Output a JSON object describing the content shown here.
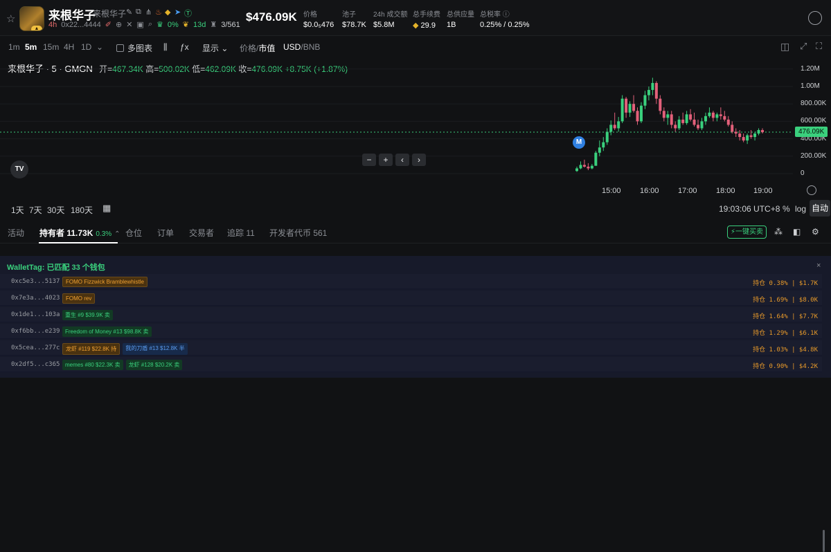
{
  "token": {
    "name": "来根华子",
    "subname": "来根华子",
    "timeframe": "4h",
    "address": "0x22...4444",
    "pct": "0%",
    "age": "13d",
    "holders_ratio": "3/561"
  },
  "header": {
    "price": "$476.09K",
    "stats": [
      {
        "label": "价格",
        "value": "$0.0₅476"
      },
      {
        "label": "池子",
        "value": "$78.7K"
      },
      {
        "label": "24h 成交额",
        "value": "$5.8M"
      },
      {
        "label": "总手续费",
        "value": "29.9"
      },
      {
        "label": "总供应量",
        "value": "1B"
      },
      {
        "label": "总税率",
        "value": "0.25% / 0.25%"
      }
    ]
  },
  "toolbar": {
    "intervals": [
      "1m",
      "5m",
      "15m",
      "4H",
      "1D"
    ],
    "active_interval": "5m",
    "multi_chart": "多图表",
    "display": "显示",
    "price_label": "价格",
    "mcap_label": "市值",
    "sep": "/",
    "usd": "USD",
    "bnb": "BNB"
  },
  "legend": {
    "title": "来根华子 · 5 · GMGN",
    "open_label": "开=",
    "open": "467.34K",
    "high_label": "高=",
    "high": "500.02K",
    "low_label": "低=",
    "low": "462.09K",
    "close_label": "收=",
    "close": "476.09K",
    "change": "+8.75K (+1.87%)"
  },
  "chart_data": {
    "type": "candlestick",
    "y_unit": "market cap (USD)",
    "ylim": [
      -50000,
      1250000
    ],
    "y_ticks": [
      "1.20M",
      "1.00M",
      "800.00K",
      "600.00K",
      "400.00K",
      "200.00K",
      "0"
    ],
    "x_ticks": [
      "15:00",
      "16:00",
      "17:00",
      "18:00",
      "19:00"
    ],
    "current": "476.09K",
    "current_value": 476090,
    "candles": [
      [
        30,
        80,
        20,
        60
      ],
      [
        60,
        140,
        50,
        100
      ],
      [
        100,
        160,
        70,
        80
      ],
      [
        80,
        120,
        40,
        60
      ],
      [
        60,
        110,
        50,
        90
      ],
      [
        90,
        260,
        90,
        240
      ],
      [
        240,
        380,
        200,
        300
      ],
      [
        300,
        420,
        260,
        360
      ],
      [
        360,
        520,
        330,
        480
      ],
      [
        480,
        610,
        440,
        560
      ],
      [
        560,
        700,
        500,
        520
      ],
      [
        520,
        650,
        480,
        600
      ],
      [
        600,
        900,
        580,
        860
      ],
      [
        860,
        880,
        640,
        700
      ],
      [
        700,
        830,
        650,
        800
      ],
      [
        800,
        900,
        700,
        720
      ],
      [
        720,
        760,
        560,
        600
      ],
      [
        600,
        820,
        580,
        780
      ],
      [
        780,
        950,
        740,
        900
      ],
      [
        900,
        1000,
        840,
        960
      ],
      [
        960,
        1100,
        900,
        1040
      ],
      [
        1040,
        1060,
        800,
        860
      ],
      [
        860,
        900,
        680,
        720
      ],
      [
        720,
        760,
        600,
        640
      ],
      [
        640,
        720,
        560,
        680
      ],
      [
        680,
        720,
        520,
        560
      ],
      [
        560,
        600,
        480,
        520
      ],
      [
        520,
        660,
        500,
        620
      ],
      [
        620,
        700,
        560,
        580
      ],
      [
        580,
        720,
        560,
        680
      ],
      [
        680,
        740,
        600,
        620
      ],
      [
        620,
        700,
        540,
        560
      ],
      [
        560,
        620,
        500,
        520
      ],
      [
        520,
        640,
        500,
        600
      ],
      [
        600,
        700,
        560,
        660
      ],
      [
        660,
        760,
        640,
        700
      ],
      [
        700,
        720,
        600,
        640
      ],
      [
        640,
        700,
        600,
        680
      ],
      [
        680,
        760,
        620,
        660
      ],
      [
        660,
        720,
        600,
        620
      ],
      [
        620,
        660,
        540,
        560
      ],
      [
        560,
        600,
        460,
        480
      ],
      [
        480,
        520,
        420,
        460
      ],
      [
        460,
        500,
        380,
        420
      ],
      [
        420,
        460,
        360,
        380
      ],
      [
        380,
        460,
        340,
        440
      ],
      [
        440,
        500,
        400,
        420
      ],
      [
        420,
        480,
        380,
        460
      ],
      [
        460,
        520,
        440,
        500
      ],
      [
        500,
        520,
        460,
        476
      ]
    ]
  },
  "chart_ui": {
    "m_badge": "M",
    "tv_logo": "TV",
    "nav": [
      "−",
      "+",
      "‹",
      "›"
    ]
  },
  "range": {
    "items": [
      "1天",
      "7天",
      "30天",
      "180天"
    ],
    "time": "19:03:06 UTC+8",
    "pct": "%",
    "log": "log",
    "auto": "自动"
  },
  "tabs": {
    "activity": "活动",
    "holders": "持有者 11.73K",
    "holders_pct": "0.3%",
    "position": "仓位",
    "orders": "订单",
    "traders": "交易者",
    "tracking": "追踪 11",
    "dev_tokens": "开发者代币 561",
    "one_click_buy": "一键买卖"
  },
  "wallettag": {
    "title": "WalletTag: 已匹配 33 个钱包",
    "close": "×",
    "rows": [
      {
        "address": "0xc5e3...5137",
        "tags": [
          {
            "text": "FOMO Fizzwick Bramblewhistle",
            "color": "orange"
          }
        ],
        "hold": "持仓 0.38% | $1.7K"
      },
      {
        "address": "0x7e3a...4023",
        "tags": [
          {
            "text": "FOMO rev",
            "color": "orange"
          }
        ],
        "hold": "持仓 1.69% | $8.0K"
      },
      {
        "address": "0x1de1...103a",
        "tags": [
          {
            "text": "重生 #9 $39.9K 卖",
            "color": "green"
          }
        ],
        "hold": "持仓 1.64% | $7.7K"
      },
      {
        "address": "0xf6bb...e239",
        "tags": [
          {
            "text": "Freedom of Money #13 $98.8K 卖",
            "color": "green"
          }
        ],
        "hold": "持仓 1.29% | $6.1K"
      },
      {
        "address": "0x5cea...277c",
        "tags": [
          {
            "text": "龙虾 #119 $22.8K 持",
            "color": "orange"
          },
          {
            "text": "我的刀盾 #13 $12.8K 半",
            "color": "blue"
          }
        ],
        "hold": "持仓 1.03% | $4.8K"
      },
      {
        "address": "0x2df5...c365",
        "tags": [
          {
            "text": "memes #80 $22.3K 卖",
            "color": "green"
          },
          {
            "text": "龙虾 #128 $20.2K 卖",
            "color": "green"
          }
        ],
        "hold": "持仓 0.90% | $4.2K"
      }
    ]
  },
  "colors": {
    "up": "#3ad07d",
    "down": "#e3607a",
    "accent": "#3ad07d"
  }
}
